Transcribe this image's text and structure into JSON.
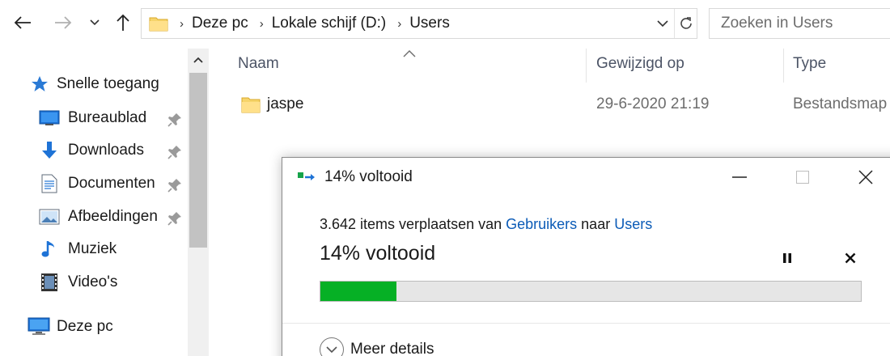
{
  "nav": {
    "back_icon": "back-arrow-icon",
    "forward_icon": "forward-arrow-icon",
    "recent_icon": "chevron-down-icon",
    "up_icon": "up-arrow-icon"
  },
  "address": {
    "crumbs": [
      "Deze pc",
      "Lokale schijf (D:)",
      "Users"
    ]
  },
  "search": {
    "placeholder": "Zoeken in Users"
  },
  "sidebar": {
    "quick_access": "Snelle toegang",
    "items": [
      {
        "label": "Bureaublad",
        "icon": "desktop-icon",
        "pinned": true
      },
      {
        "label": "Downloads",
        "icon": "download-icon",
        "pinned": true
      },
      {
        "label": "Documenten",
        "icon": "document-icon",
        "pinned": true
      },
      {
        "label": "Afbeeldingen",
        "icon": "picture-icon",
        "pinned": true
      },
      {
        "label": "Muziek",
        "icon": "music-icon",
        "pinned": false
      },
      {
        "label": "Video's",
        "icon": "video-icon",
        "pinned": false
      }
    ],
    "this_pc": "Deze pc"
  },
  "columns": {
    "name": "Naam",
    "modified": "Gewijzigd op",
    "type": "Type"
  },
  "files": [
    {
      "name": "jaspe",
      "modified": "29-6-2020 21:19",
      "type": "Bestandsmap"
    }
  ],
  "dialog": {
    "title": "14% voltooid",
    "desc_prefix": "3.642 items verplaatsen van ",
    "source": "Gebruikers",
    "desc_middle": " naar ",
    "dest": "Users",
    "big_status": "14% voltooid",
    "progress": 0.14,
    "more_details": "Meer details",
    "progress_color": "#06b025"
  }
}
